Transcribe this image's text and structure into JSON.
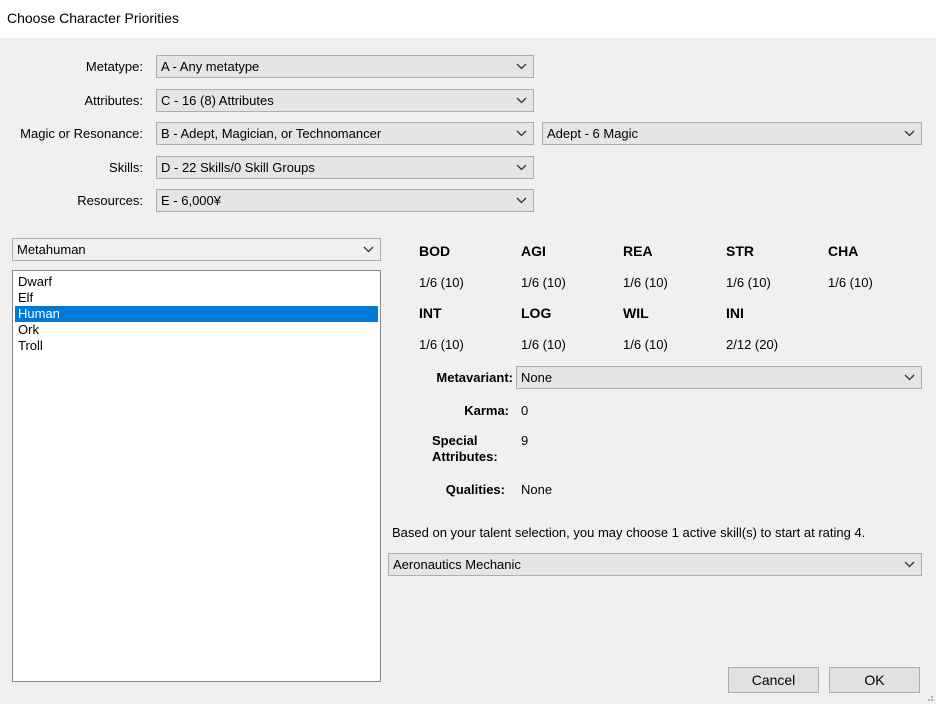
{
  "window": {
    "title": "Choose Character Priorities"
  },
  "priorities": {
    "metatype": {
      "label": "Metatype:",
      "value": "A - Any metatype"
    },
    "attributes": {
      "label": "Attributes:",
      "value": "C - 16 (8) Attributes"
    },
    "magic": {
      "label": "Magic or Resonance:",
      "value": "B - Adept, Magician, or Technomancer",
      "talent": "Adept - 6 Magic"
    },
    "skills": {
      "label": "Skills:",
      "value": "D - 22 Skills/0 Skill Groups"
    },
    "resources": {
      "label": "Resources:",
      "value": "E - 6,000¥"
    }
  },
  "category": {
    "value": "Metahuman"
  },
  "metatype_list": {
    "items": [
      "Dwarf",
      "Elf",
      "Human",
      "Ork",
      "Troll"
    ],
    "selected": "Human"
  },
  "attributes": {
    "row1": [
      {
        "name": "BOD",
        "value": "1/6 (10)"
      },
      {
        "name": "AGI",
        "value": "1/6 (10)"
      },
      {
        "name": "REA",
        "value": "1/6 (10)"
      },
      {
        "name": "STR",
        "value": "1/6 (10)"
      },
      {
        "name": "CHA",
        "value": "1/6 (10)"
      }
    ],
    "row2": [
      {
        "name": "INT",
        "value": "1/6 (10)"
      },
      {
        "name": "LOG",
        "value": "1/6 (10)"
      },
      {
        "name": "WIL",
        "value": "1/6 (10)"
      },
      {
        "name": "INI",
        "value": "2/12 (20)"
      }
    ]
  },
  "details": {
    "metavariant_label": "Metavariant:",
    "metavariant_value": "None",
    "karma_label": "Karma:",
    "karma_value": "0",
    "special_label_1": "Special",
    "special_label_2": "Attributes:",
    "special_value": "9",
    "qualities_label": "Qualities:",
    "qualities_value": "None"
  },
  "skill_notice": "Based on your talent selection, you may choose 1 active skill(s) to start at rating 4.",
  "skill_choice": "Aeronautics Mechanic",
  "buttons": {
    "cancel": "Cancel",
    "ok": "OK"
  },
  "icons": {
    "dropdown": "chevron-down-icon",
    "resize": "resize-grip-icon"
  }
}
